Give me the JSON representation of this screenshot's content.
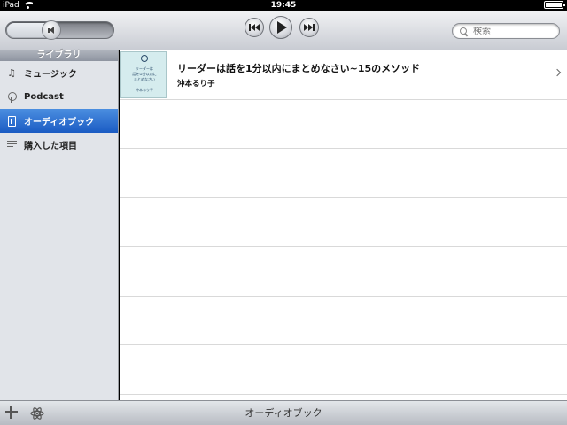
{
  "statusbar": {
    "device": "iPad",
    "time": "19:45",
    "battery_level": 1.0
  },
  "player": {
    "volume_level": 0.4
  },
  "search": {
    "placeholder": "検索"
  },
  "sidebar": {
    "header": "ライブラリ",
    "items": [
      {
        "label": "ミュージック",
        "icon": "music-note-icon",
        "active": false
      },
      {
        "label": "Podcast",
        "icon": "podcast-icon",
        "active": false
      },
      {
        "label": "オーディオブック",
        "icon": "audiobook-icon",
        "active": true
      },
      {
        "label": "購入した項目",
        "icon": "purchased-list-icon",
        "active": false
      }
    ]
  },
  "list": {
    "items": [
      {
        "title": "リーダーは話を1分以内にまとめなさい~15のメソッド",
        "author": "沖本るり子",
        "cover_lines": [
          "リーダーは",
          "話を①分以内に",
          "まとめなさい",
          "沖本るり子"
        ]
      }
    ]
  },
  "bottombar": {
    "title": "オーディオブック"
  }
}
